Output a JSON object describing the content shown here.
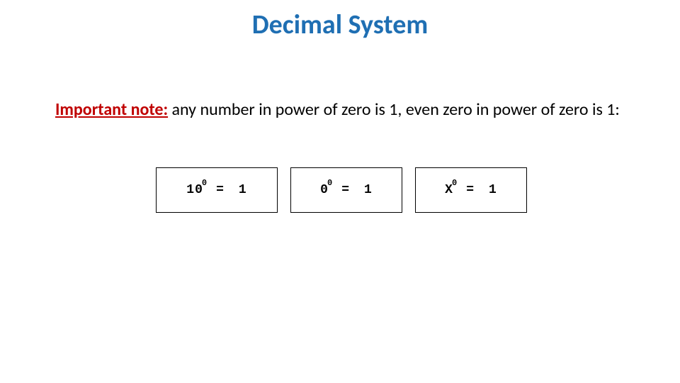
{
  "title": "Decimal System",
  "note": {
    "label": "Important note:",
    "text": " any number in power of zero is 1, even zero in power of zero is 1:"
  },
  "equations": [
    {
      "base": "10",
      "exp": "0",
      "eq": "=",
      "result": "1"
    },
    {
      "base": "0",
      "exp": "0",
      "eq": "=",
      "result": "1"
    },
    {
      "base": "X",
      "exp": "0",
      "eq": "=",
      "result": "1"
    }
  ]
}
